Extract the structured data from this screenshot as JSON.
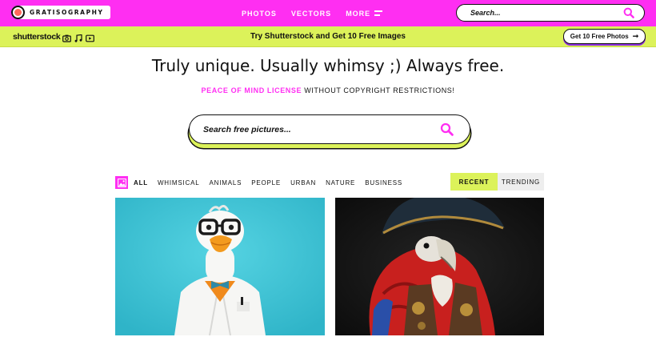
{
  "nav": {
    "logo_text": "GRATISOGRAPHY",
    "links": [
      "PHOTOS",
      "VECTORS",
      "MORE"
    ],
    "search_placeholder": "Search..."
  },
  "promo": {
    "brand": "shutterstock",
    "icons": [
      "camera-icon",
      "music-icon",
      "video-icon"
    ],
    "text": "Try Shutterstock and Get 10 Free Images",
    "button_label": "Get 10 Free Photos"
  },
  "hero": {
    "headline": "Truly unique. Usually whimsy ;) Always free.",
    "sub_highlight": "PEACE OF MIND LICENSE",
    "sub_rest": " WITHOUT COPYRIGHT RESTRICTIONS!",
    "search_placeholder": "Search free pictures..."
  },
  "filters": {
    "categories": [
      "ALL",
      "WHIMSICAL",
      "ANIMALS",
      "PEOPLE",
      "URBAN",
      "NATURE",
      "BUSINESS"
    ],
    "sort": [
      "RECENT",
      "TRENDING"
    ],
    "active_sort": "RECENT"
  },
  "colors": {
    "accent_pink": "#ff2ef2",
    "accent_lime": "#dcf25a",
    "photo_left_bg": "#3ec6d8",
    "photo_right_bg": "#141414"
  }
}
